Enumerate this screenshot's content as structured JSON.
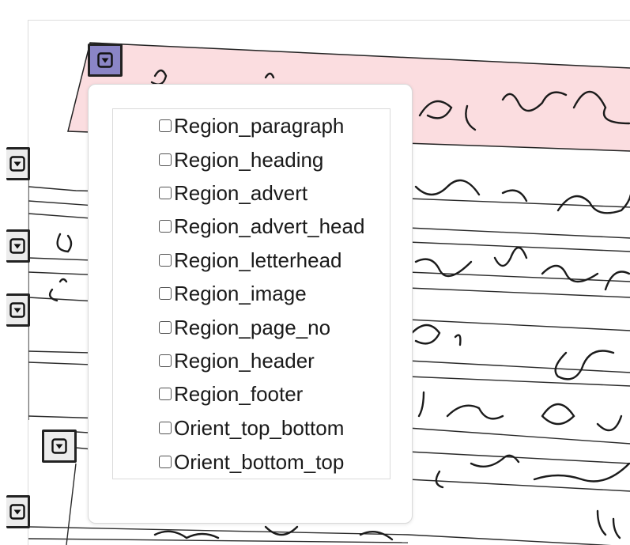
{
  "menu": {
    "options": [
      {
        "label": "Region_paragraph",
        "checked": false
      },
      {
        "label": "Region_heading",
        "checked": false
      },
      {
        "label": "Region_advert",
        "checked": false
      },
      {
        "label": "Region_advert_head",
        "checked": false
      },
      {
        "label": "Region_letterhead",
        "checked": false
      },
      {
        "label": "Region_image",
        "checked": false
      },
      {
        "label": "Region_page_no",
        "checked": false
      },
      {
        "label": "Region_header",
        "checked": false
      },
      {
        "label": "Region_footer",
        "checked": false
      },
      {
        "label": "Orient_top_bottom",
        "checked": false
      },
      {
        "label": "Orient_bottom_top",
        "checked": false
      }
    ]
  },
  "colors": {
    "highlight_region_fill": "#fbdde0",
    "active_toggle": "#8a85c6",
    "ink": "#1a1a1a"
  },
  "icons": {
    "region_toggle": "dropdown-arrow-box-icon"
  }
}
